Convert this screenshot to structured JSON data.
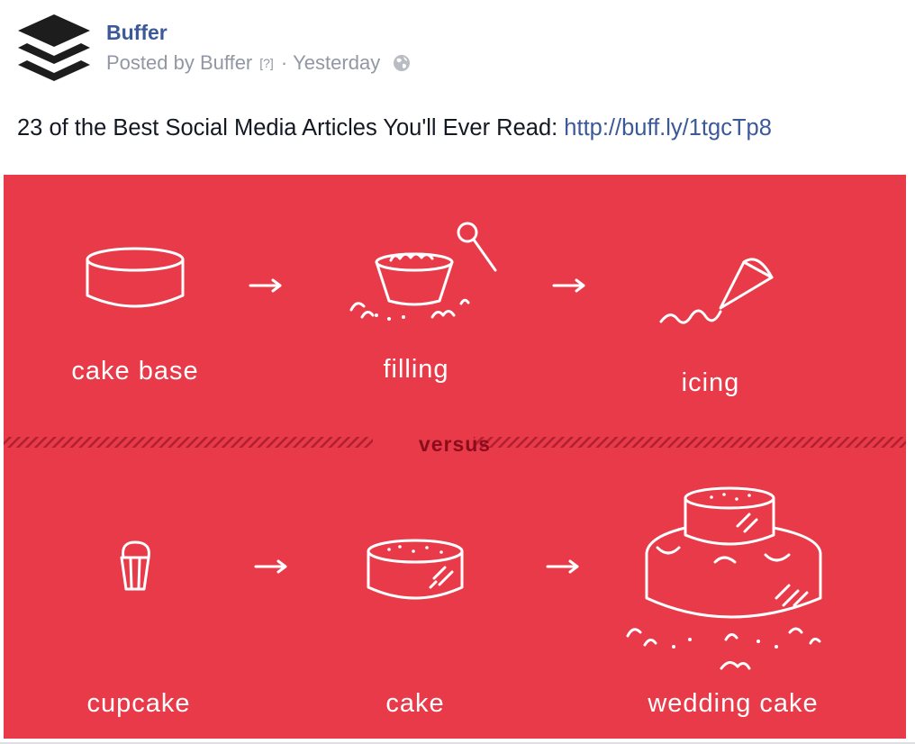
{
  "post": {
    "page_name": "Buffer",
    "posted_by": "Posted by Buffer",
    "question_mark": "[?]",
    "separator": "·",
    "time": "Yesterday",
    "icons": {
      "logo": "buffer-logo-icon",
      "audience": "globe-icon"
    },
    "text": "23 of the Best Social Media Articles You'll Ever Read: ",
    "link": "http://buff.ly/1tgcTp8"
  },
  "image": {
    "background_color": "#e83a48",
    "top_row": [
      "cake base",
      "filling",
      "icing"
    ],
    "divider": "versus",
    "bottom_row": [
      "cupcake",
      "cake",
      "wedding cake"
    ]
  }
}
